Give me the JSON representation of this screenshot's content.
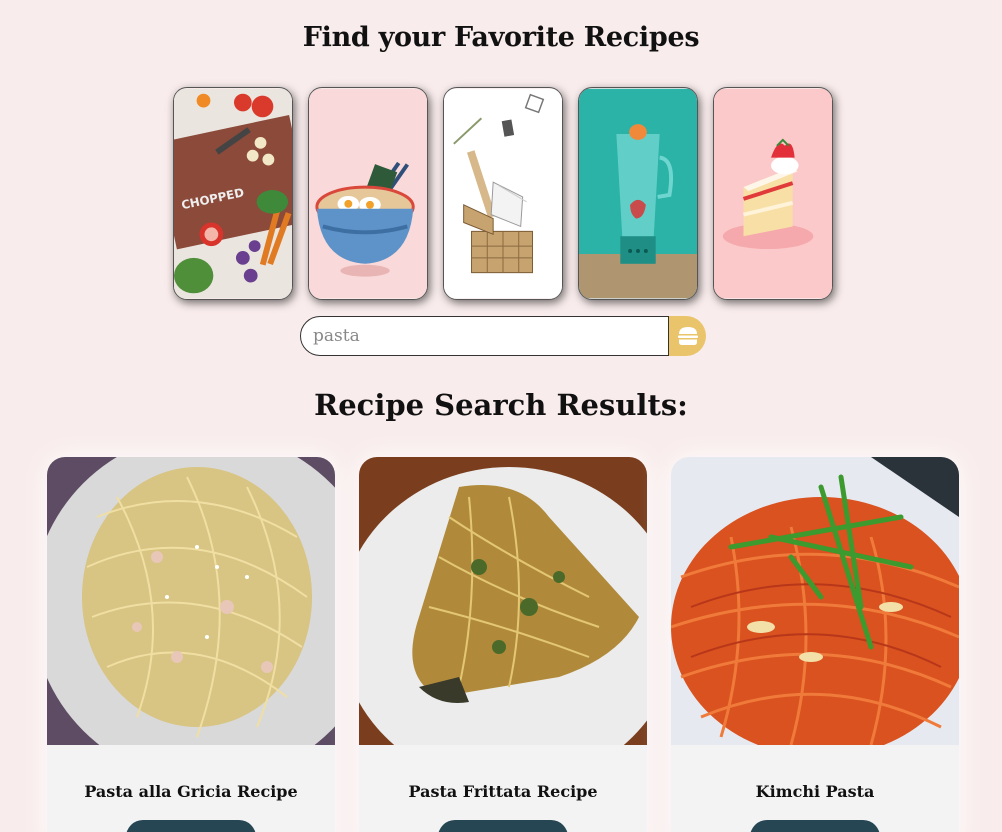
{
  "header": {
    "title": "Find your Favorite Recipes"
  },
  "categories": [
    {
      "icon": "cutting-board-vegetables-icon"
    },
    {
      "icon": "ramen-bowl-icon"
    },
    {
      "icon": "picnic-basket-icon"
    },
    {
      "icon": "blender-icon"
    },
    {
      "icon": "strawberry-cake-icon"
    }
  ],
  "search": {
    "value": "",
    "placeholder": "pasta",
    "button_icon": "burger-icon",
    "accent": "#e9c46a"
  },
  "results": {
    "title": "Recipe Search Results:",
    "items": [
      {
        "name": "Pasta alla Gricia Recipe",
        "image": "pasta-gricia-photo"
      },
      {
        "name": "Pasta Frittata Recipe",
        "image": "pasta-frittata-photo"
      },
      {
        "name": "Kimchi Pasta",
        "image": "kimchi-pasta-photo"
      }
    ]
  },
  "colors": {
    "background": "#f9ecec",
    "button": "#264653"
  }
}
